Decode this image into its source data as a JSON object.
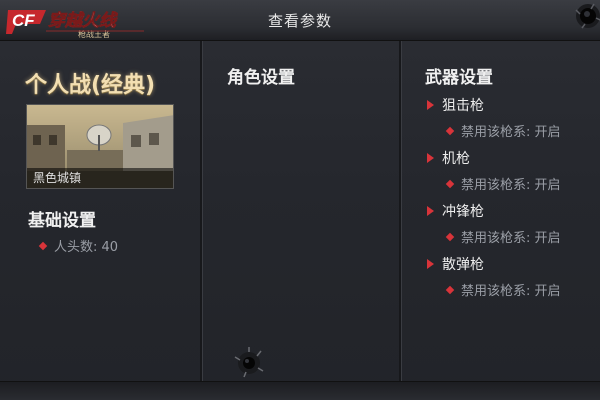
{
  "header": {
    "title": "查看参数",
    "logo_text": "穿越火线",
    "logo_sub": "枪战王者",
    "logo_mark": "CF"
  },
  "mode": {
    "title": "个人战(经典)"
  },
  "map": {
    "name": "黑色城镇"
  },
  "basic": {
    "title": "基础设置",
    "items": [
      {
        "label": "人头数: 40"
      }
    ]
  },
  "role": {
    "title": "角色设置"
  },
  "weapons": {
    "title": "武器设置",
    "groups": [
      {
        "name": "狙击枪",
        "setting": "禁用该枪系: 开启"
      },
      {
        "name": "机枪",
        "setting": "禁用该枪系: 开启"
      },
      {
        "name": "冲锋枪",
        "setting": "禁用该枪系: 开启"
      },
      {
        "name": "散弹枪",
        "setting": "禁用该枪系: 开启"
      }
    ]
  },
  "colors": {
    "accent": "#d8343a",
    "title_gold": "#f3dfb2",
    "background": "#24262c"
  },
  "icons": [
    "logo-icon",
    "bullet-hole-icon",
    "diamond-bullet-icon",
    "triangle-arrow-icon"
  ]
}
